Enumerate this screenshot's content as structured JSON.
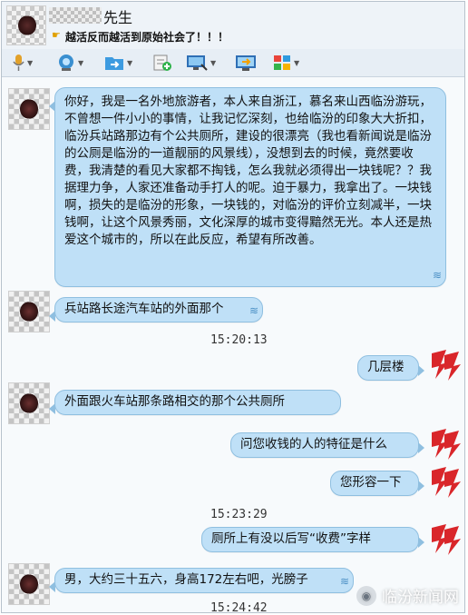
{
  "header": {
    "contact_name": "先生",
    "status_message": "越活反而越活到原始社会了！！！"
  },
  "toolbar": {
    "icons": [
      "microphone-icon",
      "video-camera-icon",
      "send-file-icon",
      "add-contact-icon",
      "screen-share-icon",
      "remote-assist-icon",
      "apps-grid-icon"
    ]
  },
  "messages": [
    {
      "side": "left",
      "text": "你好，我是一名外地旅游者，本人来自浙江，慕名来山西临汾游玩，不曾想一件小小的事情，让我记忆深刻，也给临汾的印象大大折扣，临汾兵站路那边有个公共厕所，建设的很漂亮（我也看新闻说是临汾的公厕是临汾的一道靓丽的风景线），没想到去的时候，竟然要收费，我清楚的看见大家都不掏钱，怎么我就必须得出一块钱呢？？我据理力争，人家还准备动手打人的呢。迫于暴力，我拿出了。一块钱啊，损失的是临汾的形象，一块钱的，对临汾的评价立刻减半，一块钱啊，让这个风景秀丽，文化深厚的城市变得黯然无光。本人还是热爱这个城市的，所以在此反应，希望有所改善。"
    },
    {
      "side": "left",
      "text": "兵站路长途汽车站的外面那个"
    },
    {
      "side": "time",
      "text": "15:20:13"
    },
    {
      "side": "right",
      "text": "几层楼"
    },
    {
      "side": "left",
      "text": "外面跟火车站那条路相交的那个公共厕所"
    },
    {
      "side": "right",
      "text": "问您收钱的人的特征是什么"
    },
    {
      "side": "right",
      "text": "您形容一下"
    },
    {
      "side": "time",
      "text": "15:23:29"
    },
    {
      "side": "right",
      "text": "厕所上有没以后写“收费”字样"
    },
    {
      "side": "left",
      "text": "男，大约三十五六，身高172左右吧，光膀子"
    },
    {
      "side": "time",
      "text": "15:24:42"
    }
  ],
  "watermark": {
    "text": "临汾新闻网"
  },
  "colors": {
    "bubble": "#bfe0f7",
    "bubble_border": "#8fbfe0",
    "logo_red": "#d9262a"
  }
}
